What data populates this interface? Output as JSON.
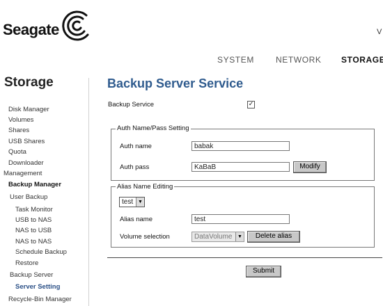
{
  "brand": {
    "name": "Seagate",
    "corner_char": "V"
  },
  "topnav": {
    "system": "SYSTEM",
    "network": "NETWORK",
    "storage": "STORAGE"
  },
  "sidebar": {
    "title": "Storage",
    "items": [
      {
        "label": "Disk Manager"
      },
      {
        "label": "Volumes"
      },
      {
        "label": "Shares"
      },
      {
        "label": "USB Shares"
      },
      {
        "label": "Quota"
      },
      {
        "label": "Downloader"
      },
      {
        "label": "Management"
      },
      {
        "label": "Backup Manager"
      },
      {
        "label": "User Backup"
      },
      {
        "label": "Task Monitor"
      },
      {
        "label": "USB to NAS"
      },
      {
        "label": "NAS to USB"
      },
      {
        "label": "NAS to NAS"
      },
      {
        "label": "Schedule Backup"
      },
      {
        "label": "Restore"
      },
      {
        "label": "Backup Server"
      },
      {
        "label": "Server Setting"
      },
      {
        "label": "Recycle-Bin Manager"
      }
    ]
  },
  "main": {
    "title": "Backup Server Service",
    "backup_service_label": "Backup Service",
    "backup_service_checked": "✓",
    "auth": {
      "legend": "Auth Name/Pass Setting",
      "name_label": "Auth name",
      "name_value": "babak",
      "pass_label": "Auth pass",
      "pass_value": "KaBaB",
      "modify_button": "Modify"
    },
    "alias": {
      "legend": "Alias Name Editing",
      "select_value": "test",
      "name_label": "Alias name",
      "name_value": "test",
      "volume_label": "Volume selection",
      "volume_value": "DataVolume",
      "delete_button": "Delete alias"
    },
    "submit_button": "Submit"
  }
}
